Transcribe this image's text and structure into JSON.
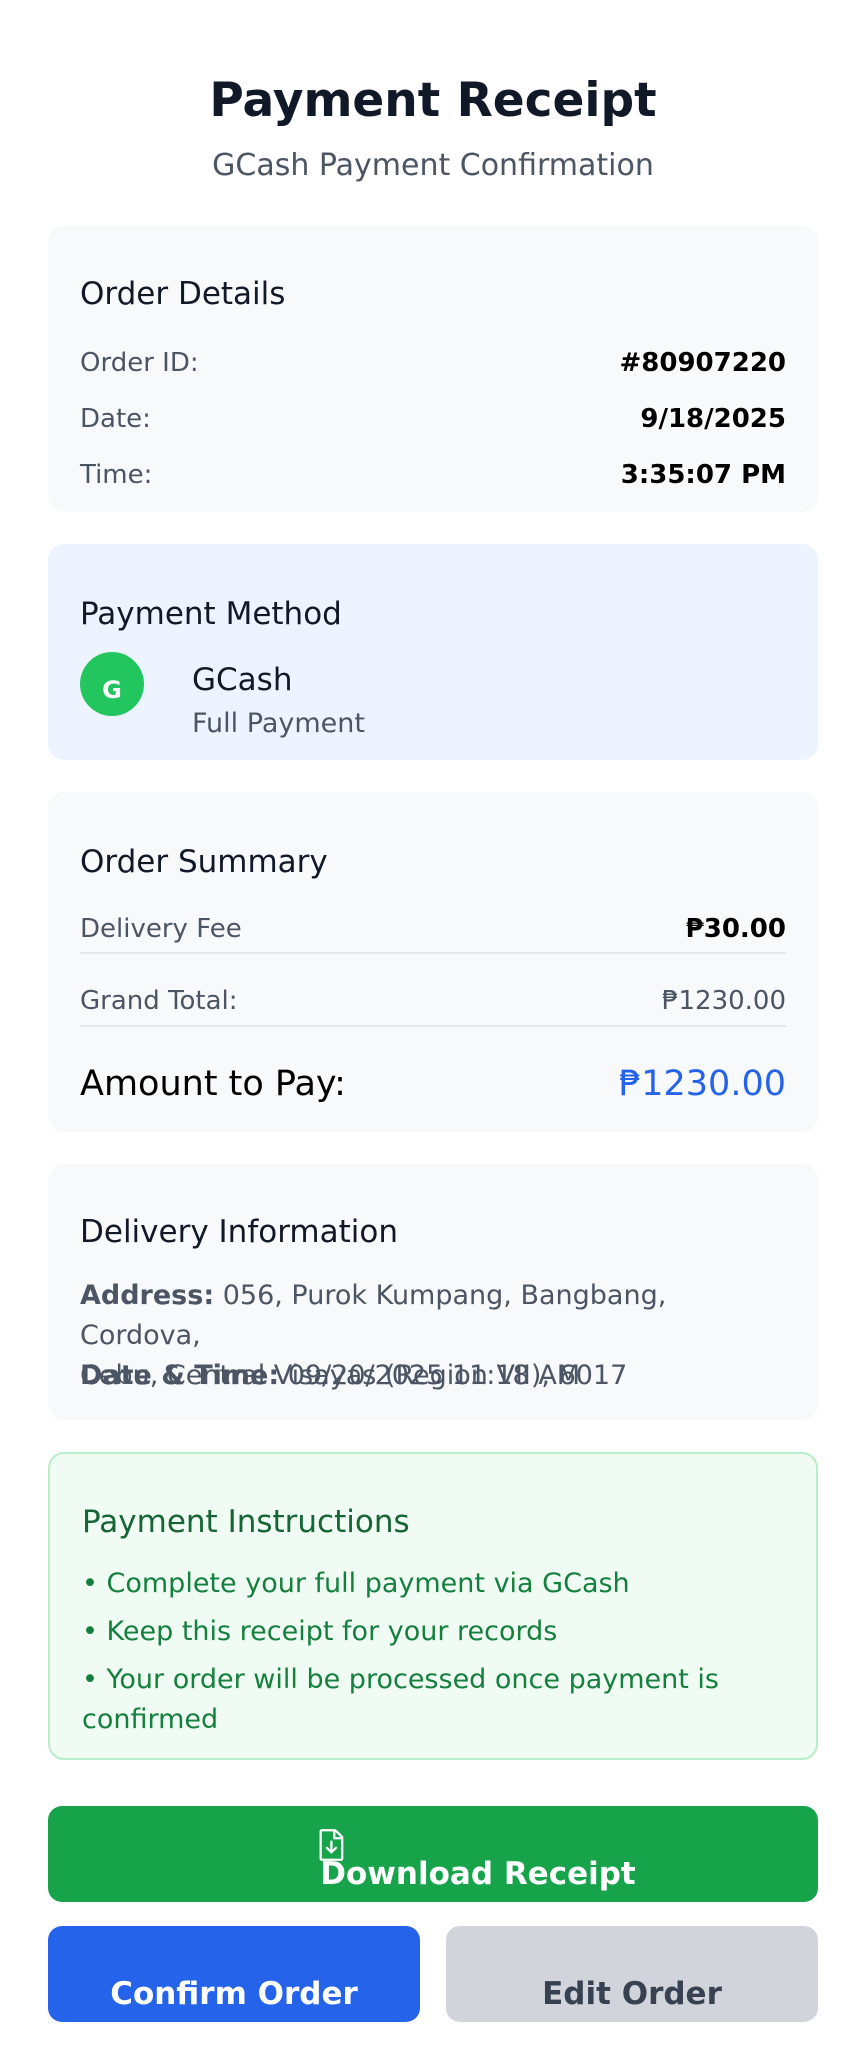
{
  "header": {
    "title": "Payment Receipt",
    "subtitle": "GCash Payment Confirmation"
  },
  "order_details": {
    "title": "Order Details",
    "rows": [
      {
        "label": "Order ID:",
        "value": "#80907220"
      },
      {
        "label": "Date:",
        "value": "9/18/2025"
      },
      {
        "label": "Time:",
        "value": "3:35:07 PM"
      }
    ]
  },
  "payment_method": {
    "title": "Payment Method",
    "logo_letter": "G",
    "name": "GCash",
    "type": "Full Payment"
  },
  "order_summary": {
    "title": "Order Summary",
    "delivery_fee_label": "Delivery Fee",
    "delivery_fee_value": "₱30.00",
    "grand_total_label": "Grand Total:",
    "grand_total_value": "₱1230.00",
    "amount_label": "Amount to Pay:",
    "amount_value": "₱1230.00"
  },
  "delivery_info": {
    "title": "Delivery Information",
    "address_label": "Address:",
    "address_line1": "056, Purok Kumpang, Bangbang, Cordova,",
    "address_line2": "Cebu, Central Visayas (Region VII), 6017",
    "datetime_label": "Date & Time:",
    "datetime_value": "09/20/2025 11:18 AM"
  },
  "instructions": {
    "title": "Payment Instructions",
    "items": [
      "• Complete your full payment via GCash",
      "• Keep this receipt for your records",
      "• Your order will be processed once payment is",
      "confirmed"
    ]
  },
  "buttons": {
    "download": "Download Receipt",
    "confirm": "Confirm Order",
    "edit": "Edit Order"
  },
  "colors": {
    "accent_blue": "#2563eb",
    "success_green": "#16a34a",
    "gcash_green": "#22c55e"
  }
}
